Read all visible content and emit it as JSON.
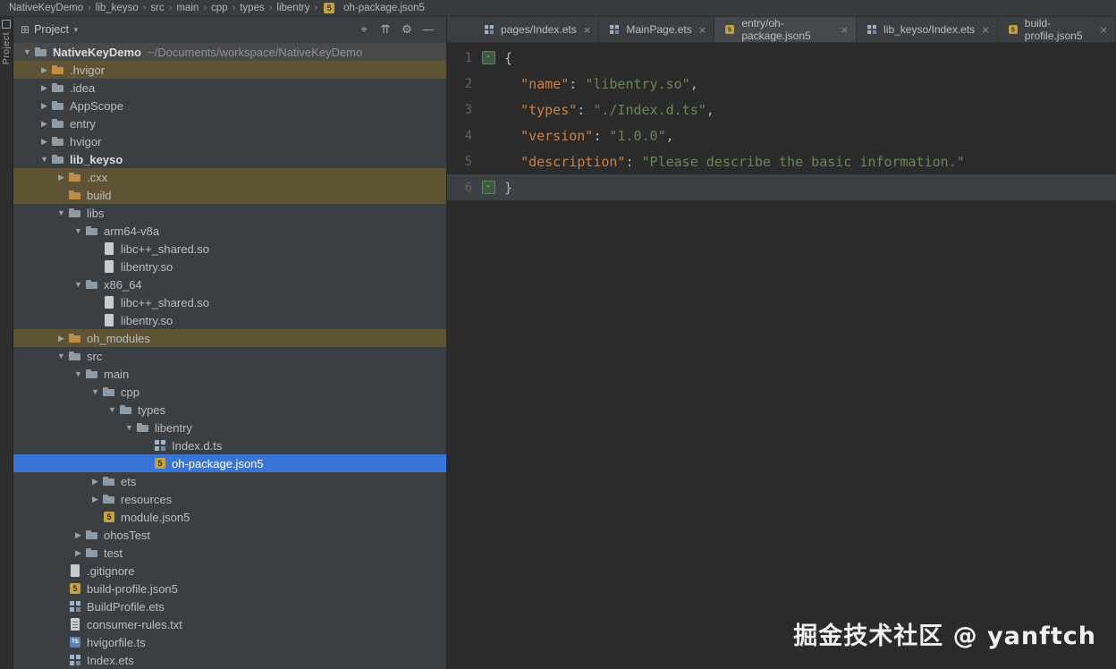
{
  "window": {
    "watermark": "掘金技术社区 @ yanftch"
  },
  "colors": {
    "selection_blue": "#3875d6",
    "excluded_row": "#5e5434",
    "json_key": "#cc8242",
    "json_string": "#6a8759",
    "editor_bg": "#2b2b2b",
    "panel_bg": "#3c3f41"
  },
  "breadcrumb_bar": {
    "separator": "›",
    "items": [
      {
        "label": "NativeKeyDemo",
        "icon": ""
      },
      {
        "label": "lib_keyso",
        "icon": ""
      },
      {
        "label": "src",
        "icon": ""
      },
      {
        "label": "main",
        "icon": ""
      },
      {
        "label": "cpp",
        "icon": ""
      },
      {
        "label": "types",
        "icon": ""
      },
      {
        "label": "libentry",
        "icon": ""
      },
      {
        "label": "oh-package.json5",
        "icon": "json5"
      }
    ]
  },
  "tool_window_bar": {
    "project_tab": "Project"
  },
  "project_panel": {
    "title": "Project",
    "header_icons": [
      {
        "name": "select-opened-file",
        "glyph": "⌖"
      },
      {
        "name": "collapse-all",
        "glyph": "⇈"
      },
      {
        "name": "settings",
        "glyph": "⚙"
      },
      {
        "name": "hide-panel",
        "glyph": "—"
      }
    ],
    "tree": [
      {
        "depth": 0,
        "chev": "expanded",
        "icon": "folder",
        "label": "NativeKeyDemo",
        "suffix": "~/Documents/workspace/NativeKeyDemo",
        "row": "root",
        "bold": true
      },
      {
        "depth": 1,
        "chev": "collapsed",
        "icon": "folder-ex",
        "label": ".hvigor",
        "row": "excluded"
      },
      {
        "depth": 1,
        "chev": "collapsed",
        "icon": "folder",
        "label": ".idea"
      },
      {
        "depth": 1,
        "chev": "collapsed",
        "icon": "folder",
        "label": "AppScope"
      },
      {
        "depth": 1,
        "chev": "collapsed",
        "icon": "folder",
        "label": "entry"
      },
      {
        "depth": 1,
        "chev": "collapsed",
        "icon": "folder",
        "label": "hvigor"
      },
      {
        "depth": 1,
        "chev": "expanded",
        "icon": "folder",
        "label": "lib_keyso",
        "bold": true
      },
      {
        "depth": 2,
        "chev": "collapsed",
        "icon": "folder-ex",
        "label": ".cxx",
        "row": "excluded"
      },
      {
        "depth": 2,
        "chev": "",
        "icon": "folder-ex",
        "label": "build",
        "row": "excluded"
      },
      {
        "depth": 2,
        "chev": "expanded",
        "icon": "folder",
        "label": "libs"
      },
      {
        "depth": 3,
        "chev": "expanded",
        "icon": "folder",
        "label": "arm64-v8a"
      },
      {
        "depth": 4,
        "chev": "",
        "icon": "file",
        "label": "libc++_shared.so"
      },
      {
        "depth": 4,
        "chev": "",
        "icon": "file",
        "label": "libentry.so"
      },
      {
        "depth": 3,
        "chev": "expanded",
        "icon": "folder",
        "label": "x86_64"
      },
      {
        "depth": 4,
        "chev": "",
        "icon": "file",
        "label": "libc++_shared.so"
      },
      {
        "depth": 4,
        "chev": "",
        "icon": "file",
        "label": "libentry.so"
      },
      {
        "depth": 2,
        "chev": "collapsed",
        "icon": "folder-ex",
        "label": "oh_modules",
        "row": "excluded"
      },
      {
        "depth": 2,
        "chev": "expanded",
        "icon": "folder",
        "label": "src"
      },
      {
        "depth": 3,
        "chev": "expanded",
        "icon": "folder",
        "label": "main"
      },
      {
        "depth": 4,
        "chev": "expanded",
        "icon": "folder",
        "label": "cpp"
      },
      {
        "depth": 5,
        "chev": "expanded",
        "icon": "folder",
        "label": "types"
      },
      {
        "depth": 6,
        "chev": "expanded",
        "icon": "folder",
        "label": "libentry"
      },
      {
        "depth": 7,
        "chev": "",
        "icon": "ets",
        "label": "Index.d.ts"
      },
      {
        "depth": 7,
        "chev": "",
        "icon": "json5",
        "label": "oh-package.json5",
        "row": "selected"
      },
      {
        "depth": 4,
        "chev": "collapsed",
        "icon": "folder",
        "label": "ets"
      },
      {
        "depth": 4,
        "chev": "collapsed",
        "icon": "folder",
        "label": "resources"
      },
      {
        "depth": 4,
        "chev": "",
        "icon": "json5",
        "label": "module.json5"
      },
      {
        "depth": 3,
        "chev": "collapsed",
        "icon": "folder",
        "label": "ohosTest"
      },
      {
        "depth": 3,
        "chev": "collapsed",
        "icon": "folder",
        "label": "test"
      },
      {
        "depth": 2,
        "chev": "",
        "icon": "file",
        "label": ".gitignore"
      },
      {
        "depth": 2,
        "chev": "",
        "icon": "json5",
        "label": "build-profile.json5"
      },
      {
        "depth": 2,
        "chev": "",
        "icon": "ets",
        "label": "BuildProfile.ets"
      },
      {
        "depth": 2,
        "chev": "",
        "icon": "txt",
        "label": "consumer-rules.txt"
      },
      {
        "depth": 2,
        "chev": "",
        "icon": "ts",
        "label": "hvigorfile.ts"
      },
      {
        "depth": 2,
        "chev": "",
        "icon": "ets",
        "label": "Index.ets"
      }
    ]
  },
  "editor": {
    "tab_close_glyph": "×",
    "tabs": [
      {
        "icon": "ets",
        "label": "pages/Index.ets"
      },
      {
        "icon": "ets",
        "label": "MainPage.ets"
      },
      {
        "icon": "json5",
        "label": "entry/oh-package.json5",
        "active": true
      },
      {
        "icon": "ets",
        "label": "lib_keyso/Index.ets"
      },
      {
        "icon": "json5",
        "label": "build-profile.json5"
      }
    ],
    "lines": [
      {
        "n": "1",
        "fold": true,
        "seg": [
          [
            "p",
            "{"
          ]
        ]
      },
      {
        "n": "2",
        "seg": [
          [
            "t",
            "  "
          ],
          [
            "k",
            "\"name\""
          ],
          [
            "p",
            ": "
          ],
          [
            "s",
            "\"libentry.so\""
          ],
          [
            "p",
            ","
          ]
        ]
      },
      {
        "n": "3",
        "seg": [
          [
            "t",
            "  "
          ],
          [
            "k",
            "\"types\""
          ],
          [
            "p",
            ": "
          ],
          [
            "s",
            "\"./Index.d.ts\""
          ],
          [
            "p",
            ","
          ]
        ]
      },
      {
        "n": "4",
        "seg": [
          [
            "t",
            "  "
          ],
          [
            "k",
            "\"version\""
          ],
          [
            "p",
            ": "
          ],
          [
            "s",
            "\"1.0.0\""
          ],
          [
            "p",
            ","
          ]
        ]
      },
      {
        "n": "5",
        "seg": [
          [
            "t",
            "  "
          ],
          [
            "k",
            "\"description\""
          ],
          [
            "p",
            ": "
          ],
          [
            "s",
            "\"Please describe the basic information.\""
          ]
        ]
      },
      {
        "n": "6",
        "fold": true,
        "caret": true,
        "seg": [
          [
            "p",
            "}"
          ]
        ]
      }
    ]
  }
}
